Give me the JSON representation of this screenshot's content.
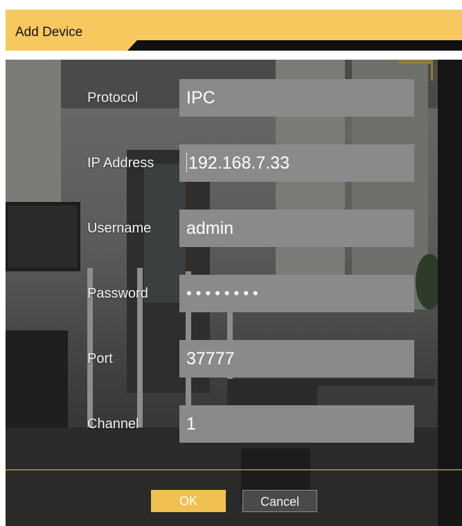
{
  "dialog": {
    "title": "Add Device",
    "accent_color": "#f6c85e"
  },
  "form": {
    "protocol": {
      "label": "Protocol",
      "value": "IPC"
    },
    "ip_address": {
      "label": "IP Address",
      "value": "192.168.7.33"
    },
    "username": {
      "label": "Username",
      "value": "admin"
    },
    "password": {
      "label": "Password",
      "value": "••••••••"
    },
    "port": {
      "label": "Port",
      "value": "37777"
    },
    "channel": {
      "label": "Channel",
      "value": "1"
    }
  },
  "buttons": {
    "ok_label": "OK",
    "cancel_label": "Cancel"
  }
}
